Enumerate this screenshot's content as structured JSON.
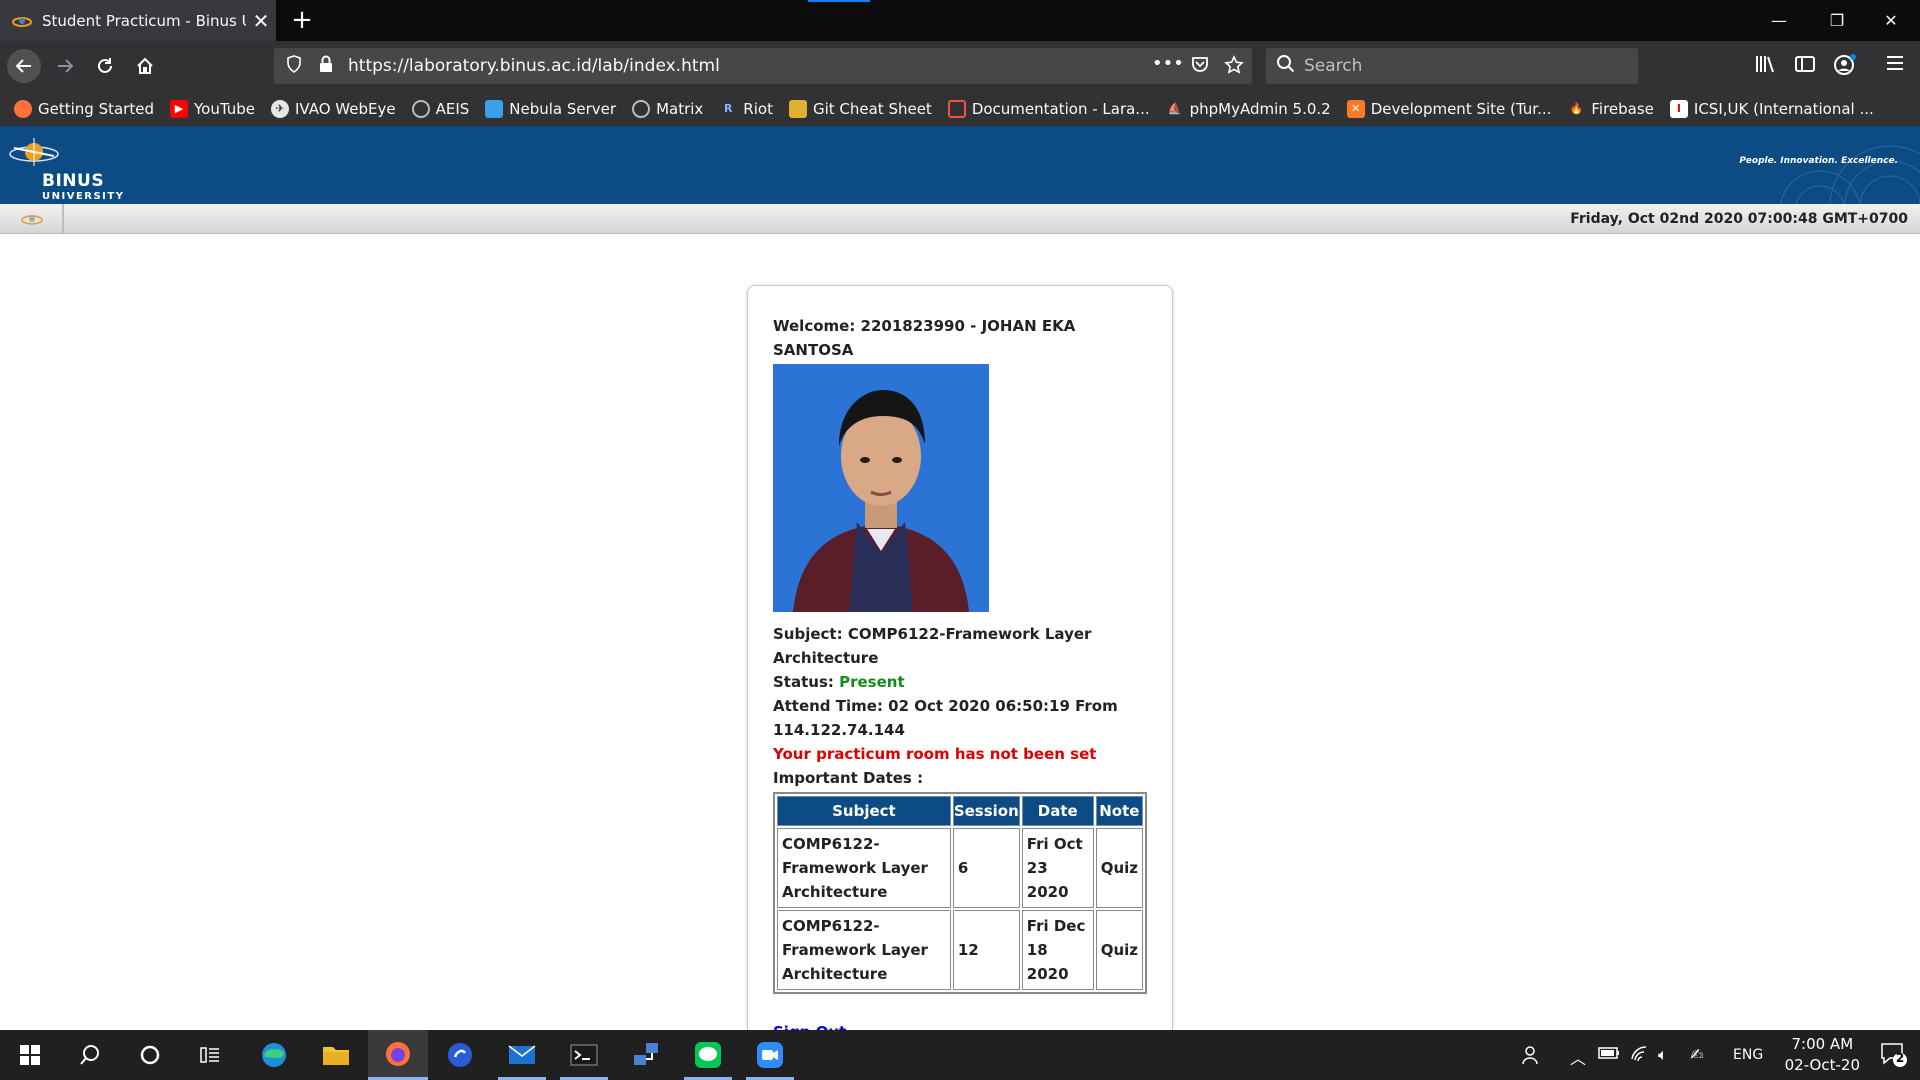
{
  "browser": {
    "tab_title": "Student Practicum - Binus Univ",
    "url": "https://laboratory.binus.ac.id/lab/index.html",
    "search_placeholder": "Search",
    "bookmarks": [
      {
        "label": "Getting Started",
        "icon": "firefox-icon",
        "color": "#ff7139"
      },
      {
        "label": "YouTube",
        "icon": "youtube-icon",
        "color": "#ff0000"
      },
      {
        "label": "IVAO WebEye",
        "icon": "plane-icon",
        "color": "#dddddd"
      },
      {
        "label": "AEIS",
        "icon": "globe-icon",
        "color": "#bbbbbb"
      },
      {
        "label": "Nebula Server",
        "icon": "nebula-icon",
        "color": "#3aa0e8"
      },
      {
        "label": "Matrix",
        "icon": "globe-icon",
        "color": "#bbbbbb"
      },
      {
        "label": "Riot",
        "icon": "riot-icon",
        "color": "#4a90d9"
      },
      {
        "label": "Git Cheat Sheet",
        "icon": "git-icon",
        "color": "#e0b030"
      },
      {
        "label": "Documentation - Lara...",
        "icon": "laravel-icon",
        "color": "#f05340"
      },
      {
        "label": "phpMyAdmin 5.0.2",
        "icon": "phpmyadmin-icon",
        "color": "#f0a030"
      },
      {
        "label": "Development Site (Tur...",
        "icon": "xampp-icon",
        "color": "#fb7a24"
      },
      {
        "label": "Firebase",
        "icon": "firebase-icon",
        "color": "#ffca28"
      },
      {
        "label": "ICSI,UK (International ...",
        "icon": "icsi-icon",
        "color": "#d01010"
      }
    ]
  },
  "site": {
    "logo_name": "BINUS",
    "logo_sub": "UNIVERSITY",
    "tagline": "People. Innovation. Excellence.",
    "datetime": "Friday, Oct 02nd 2020 07:00:48 GMT+0700",
    "brand_color": "#0d4b84"
  },
  "card": {
    "welcome": "Welcome: 2201823990 - JOHAN EKA SANTOSA",
    "subject_label": "Subject:",
    "subject_value": "COMP6122-Framework Layer Architecture",
    "status_label": "Status:",
    "status_value": "Present",
    "attend_label": "Attend Time:",
    "attend_value": "02 Oct 2020 06:50:19 From 114.122.74.144",
    "room_warning": "Your practicum room has not been set",
    "important_dates_label": "Important Dates :",
    "table": {
      "headers": [
        "Subject",
        "Session",
        "Date",
        "Note"
      ],
      "rows": [
        [
          "COMP6122-Framework Layer Architecture",
          "6",
          "Fri Oct 23 2020",
          "Quiz"
        ],
        [
          "COMP6122-Framework Layer Architecture",
          "12",
          "Fri Dec 18 2020",
          "Quiz"
        ]
      ]
    },
    "signout": "Sign Out"
  },
  "taskbar": {
    "language": "ENG",
    "time": "7:00 AM",
    "date": "02-Oct-20",
    "notification_count": "2"
  }
}
